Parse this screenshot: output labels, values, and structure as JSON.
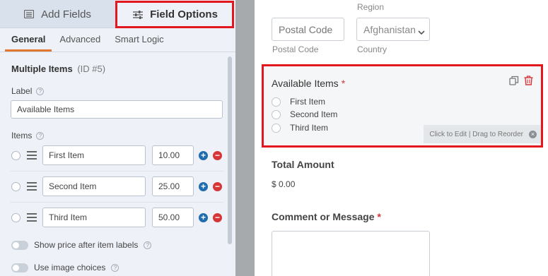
{
  "tabs": {
    "add_fields": "Add Fields",
    "field_options": "Field Options"
  },
  "subtabs": [
    "General",
    "Advanced",
    "Smart Logic"
  ],
  "field": {
    "name": "Multiple Items",
    "id_text": "(ID #5)"
  },
  "label_section": {
    "label": "Label",
    "value": "Available Items"
  },
  "items_section": {
    "label": "Items",
    "rows": [
      {
        "name": "First Item",
        "price": "10.00"
      },
      {
        "name": "Second Item",
        "price": "25.00"
      },
      {
        "name": "Third Item",
        "price": "50.00"
      }
    ]
  },
  "toggles": [
    {
      "label": "Show price after item labels",
      "on": false
    },
    {
      "label": "Use image choices",
      "on": false
    }
  ],
  "preview": {
    "top_partial_label": "Region",
    "postal_placeholder": "Postal Code",
    "postal_sublabel": "Postal Code",
    "country_value": "Afghanistan",
    "country_sublabel": "Country",
    "items_title": "Available Items",
    "required_mark": "*",
    "choices": [
      "First Item",
      "Second Item",
      "Third Item"
    ],
    "edit_hint": "Click to Edit | Drag to Reorder",
    "total_title": "Total Amount",
    "total_value": "$ 0.00",
    "comment_title": "Comment or Message"
  },
  "colors": {
    "highlight": "#e3171e",
    "active_tab_underline": "#e27730",
    "add_button": "#1f6cb0",
    "delete_button": "#d63638"
  },
  "icons": [
    "list-icon",
    "sliders-icon",
    "help-icon",
    "drag-handle-icon",
    "add-circle-icon",
    "remove-circle-icon",
    "duplicate-icon",
    "trash-icon",
    "close-icon",
    "chevron-down-icon"
  ]
}
